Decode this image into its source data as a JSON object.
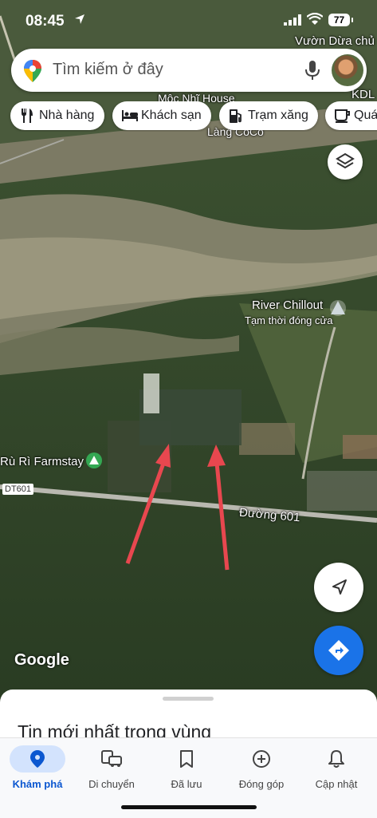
{
  "status_bar": {
    "time": "08:45",
    "battery": "77"
  },
  "search": {
    "placeholder": "Tìm kiếm ở đây"
  },
  "chips": [
    {
      "label": "Nhà hàng",
      "icon": "restaurant-icon"
    },
    {
      "label": "Khách sạn",
      "icon": "hotel-icon"
    },
    {
      "label": "Trạm xăng",
      "icon": "gas-station-icon"
    },
    {
      "label": "Quá",
      "icon": "coffee-icon"
    }
  ],
  "map": {
    "labels": {
      "vuon_dua": "Vườn Dừa chủ",
      "moc_nhi": "Mộc Nhĩ House",
      "kdl": "KDL",
      "lang_coco": "Làng CoCo",
      "river_name": "River Chillout",
      "river_status": "Tạm thời đóng cửa",
      "farmstay": "Rù Rì Farmstay",
      "road_badge": "DT601",
      "road_name": "Đường 601"
    },
    "logo": "Google"
  },
  "sheet": {
    "title": "Tin mới nhất trong vùng"
  },
  "nav": [
    {
      "label": "Khám phá",
      "icon": "explore-pin-icon",
      "active": true
    },
    {
      "label": "Di chuyển",
      "icon": "commute-icon",
      "active": false
    },
    {
      "label": "Đã lưu",
      "icon": "bookmark-icon",
      "active": false
    },
    {
      "label": "Đóng góp",
      "icon": "add-circle-icon",
      "active": false
    },
    {
      "label": "Cập nhật",
      "icon": "bell-icon",
      "active": false
    }
  ],
  "colors": {
    "accent": "#1a73e8",
    "active_pill": "#d3e3fd",
    "arrow": "#e8474f"
  }
}
